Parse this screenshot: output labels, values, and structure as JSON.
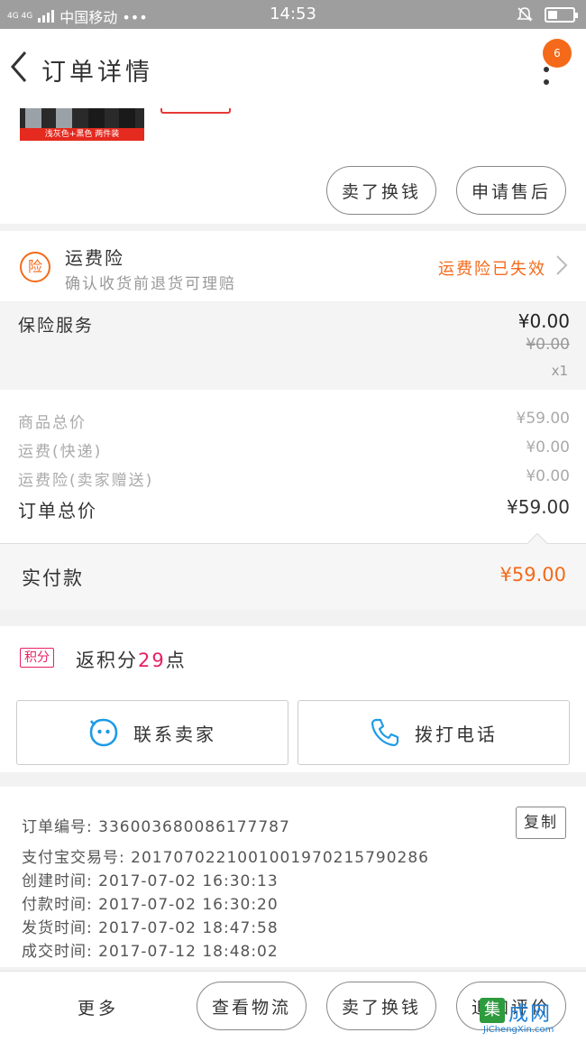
{
  "status_bar": {
    "network": "4G 4G",
    "carrier": "中国移动 •••",
    "time": "14:53"
  },
  "header": {
    "title": "订单详情",
    "badge_count": "6"
  },
  "product": {
    "variant_label": "浅灰色+黑色 两件装",
    "actions": [
      "卖了换钱",
      "申请售后"
    ]
  },
  "insurance": {
    "icon_text": "险",
    "title": "运费险",
    "subtitle": "确认收货前退货可理赔",
    "status": "运费险已失效"
  },
  "service": {
    "label": "保险服务",
    "price": "¥0.00",
    "original_price": "¥0.00",
    "quantity": "x1"
  },
  "summary": {
    "rows": [
      {
        "label": "商品总价",
        "value": "¥59.00"
      },
      {
        "label": "运费(快递)",
        "value": "¥0.00"
      },
      {
        "label": "运费险(卖家赠送)",
        "value": "¥0.00"
      },
      {
        "label": "订单总价",
        "value": "¥59.00"
      }
    ]
  },
  "paid": {
    "label": "实付款",
    "value": "¥59.00"
  },
  "points": {
    "tag": "积分",
    "prefix": "返积分",
    "number": "29",
    "suffix": "点"
  },
  "contact": {
    "seller_label": "联系卖家",
    "phone_label": "拨打电话"
  },
  "order_info": {
    "order_no": "订单编号: 336003680086177787",
    "alipay_no": "支付宝交易号: 2017070221001001970215790286",
    "created": "创建时间: 2017-07-02 16:30:13",
    "paid": "付款时间: 2017-07-02 16:30:20",
    "shipped": "发货时间: 2017-07-02 18:47:58",
    "completed": "成交时间: 2017-07-12 18:48:02",
    "copy_label": "复制"
  },
  "bottom_bar": {
    "more": "更多",
    "buttons": [
      "查看物流",
      "卖了换钱",
      "追加评价"
    ]
  },
  "watermark": {
    "icon": "集",
    "name": "成网",
    "url": "JiChengXin.com"
  },
  "colors": {
    "accent": "#f46a1a",
    "points": "#e91e63",
    "status_bar": "#9e9e9e"
  }
}
